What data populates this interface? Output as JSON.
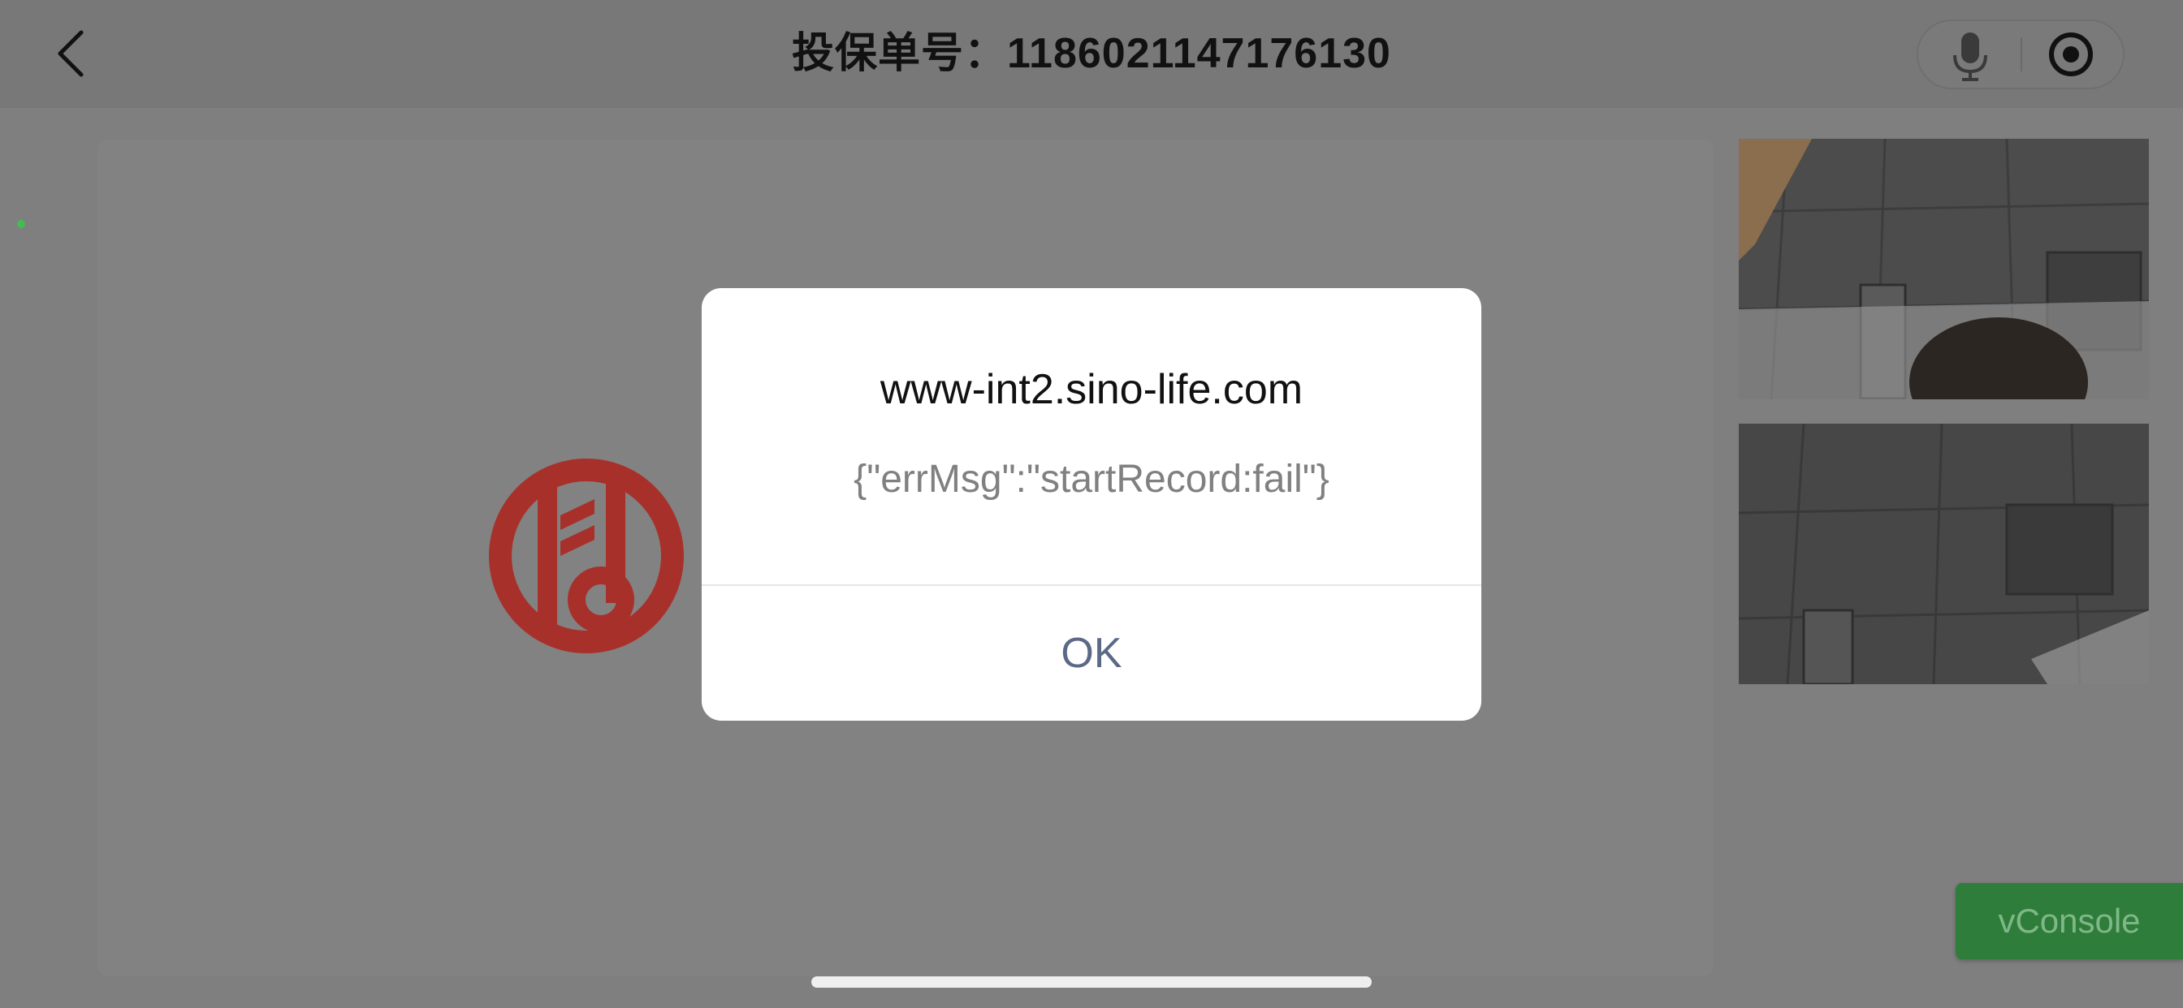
{
  "navbar": {
    "title": "投保单号：1186021147176130",
    "back_icon": "chevron-left-icon",
    "mic_icon": "microphone-icon",
    "record_icon": "record-target-icon"
  },
  "main": {
    "logo_icon": "sino-life-logo-icon",
    "logo_color": "#b02a22",
    "status_dot_color": "#3fbf4f"
  },
  "cameras": [
    {
      "name": "local-camera-feed"
    },
    {
      "name": "remote-camera-feed"
    }
  ],
  "dialog": {
    "title": "www-int2.sino-life.com",
    "message": "{\"errMsg\":\"startRecord:fail\"}",
    "ok_label": "OK"
  },
  "vconsole": {
    "label": "vConsole",
    "color": "#2f7d3a"
  }
}
